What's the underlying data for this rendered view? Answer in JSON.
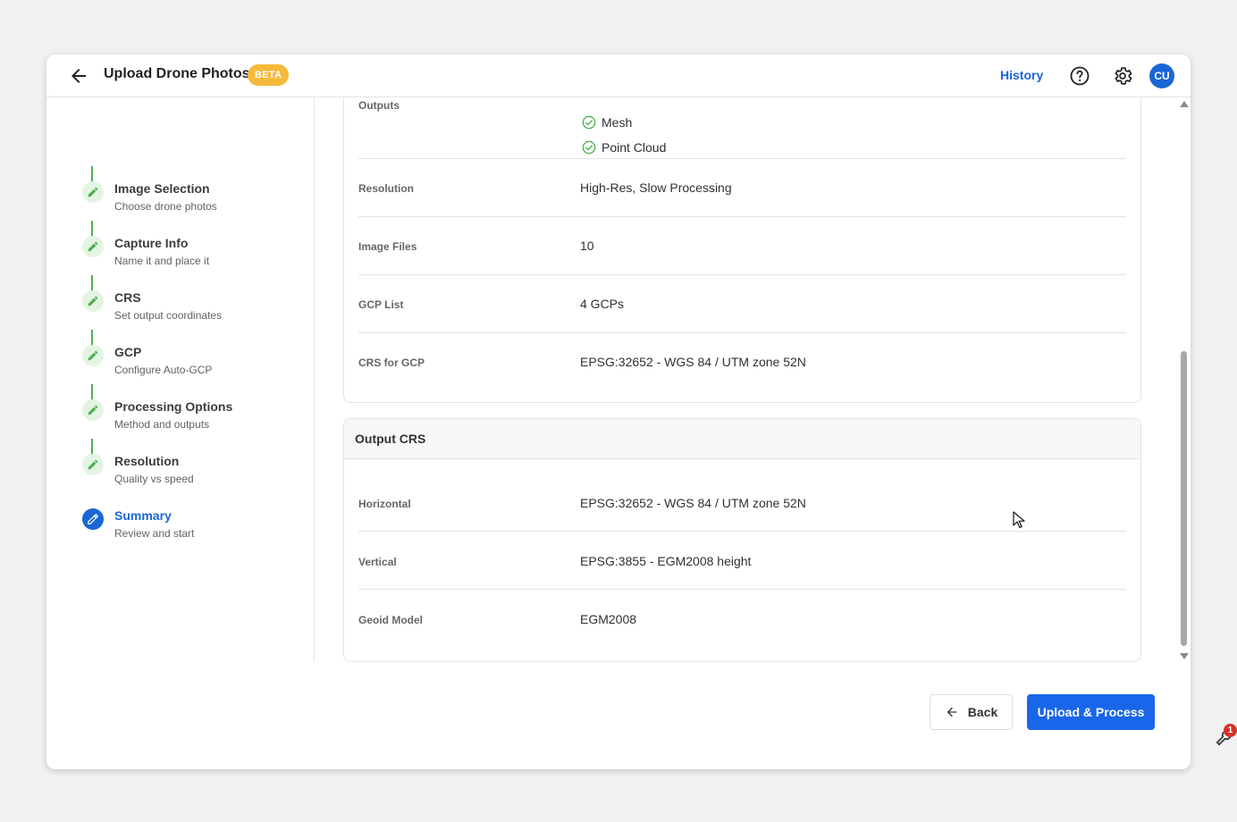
{
  "header": {
    "title": "Upload Drone Photos",
    "badge": "BETA",
    "history_label": "History",
    "avatar_initials": "CU",
    "icons": [
      "back-arrow-icon",
      "help-icon",
      "gear-icon"
    ]
  },
  "stepper": {
    "steps": [
      {
        "title": "Image Selection",
        "subtitle": "Choose drone photos",
        "status": "done"
      },
      {
        "title": "Capture Info",
        "subtitle": "Name it and place it",
        "status": "done"
      },
      {
        "title": "CRS",
        "subtitle": "Set output coordinates",
        "status": "done"
      },
      {
        "title": "GCP",
        "subtitle": "Configure Auto-GCP",
        "status": "done"
      },
      {
        "title": "Processing Options",
        "subtitle": "Method and outputs",
        "status": "done"
      },
      {
        "title": "Resolution",
        "subtitle": "Quality vs speed",
        "status": "done"
      },
      {
        "title": "Summary",
        "subtitle": "Review and start",
        "status": "active"
      }
    ]
  },
  "summary": {
    "outputs_label": "Outputs",
    "outputs": [
      "Mesh",
      "Point Cloud"
    ],
    "rows": [
      {
        "label": "Resolution",
        "value": "High-Res, Slow Processing"
      },
      {
        "label": "Image Files",
        "value": "10"
      },
      {
        "label": "GCP List",
        "value": "4 GCPs"
      },
      {
        "label": "CRS for GCP",
        "value": "EPSG:32652 - WGS 84 / UTM zone 52N"
      }
    ]
  },
  "output_crs": {
    "title": "Output CRS",
    "rows": [
      {
        "label": "Horizontal",
        "value": "EPSG:32652 - WGS 84 / UTM zone 52N"
      },
      {
        "label": "Vertical",
        "value": "EPSG:3855 - EGM2008 height"
      },
      {
        "label": "Geoid Model",
        "value": "EGM2008"
      }
    ]
  },
  "footer": {
    "back_label": "Back",
    "primary_label": "Upload & Process"
  },
  "notifications": {
    "count": "1"
  },
  "colors": {
    "accent": "#1a66ea",
    "success": "#4caf50",
    "beta": "#f6b93b"
  }
}
